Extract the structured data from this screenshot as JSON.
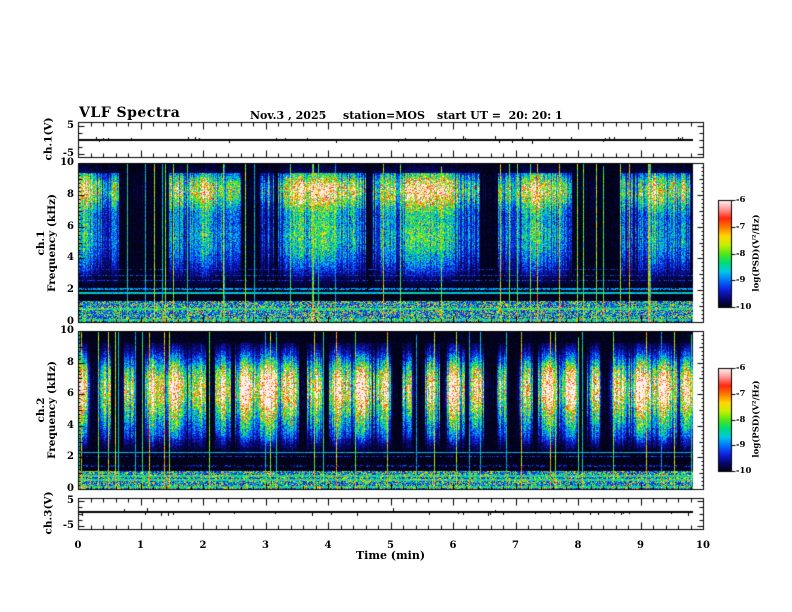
{
  "header": {
    "title": "VLF Spectra",
    "date": "Nov.3 , 2025",
    "station": "station=MOS",
    "start_ut": "start UT =  20: 20: 1"
  },
  "time_axis": {
    "label": "Time (min)",
    "ticks": [
      "0",
      "1",
      "2",
      "3",
      "4",
      "5",
      "6",
      "7",
      "8",
      "9",
      "10"
    ],
    "range_min": [
      0,
      10
    ],
    "minor_tick_step_min": 0.2,
    "data_end_min": 9.84
  },
  "chart_data": [
    {
      "id": "ch1_waveform",
      "type": "line",
      "ylabel": "ch.1(V)",
      "yticks": [
        5,
        -5
      ],
      "ylim": [
        -6.25,
        6.25
      ],
      "x_minutes": [
        0,
        9.84
      ],
      "mean_v": 0,
      "description": "flat trace near 0 V with sparse tiny impulses"
    },
    {
      "id": "ch1_spectrogram",
      "type": "heatmap",
      "ylabel_channel": "ch.1",
      "ylabel_axis": "Frequency (kHz)",
      "yticks": [
        0,
        2,
        4,
        6,
        8,
        10
      ],
      "ylim_khz": [
        0,
        10
      ],
      "x_minutes": [
        0,
        9.84
      ],
      "z_label": "log(PSD)(V²/Hz)",
      "z_range": [
        -10,
        -6
      ],
      "features": {
        "strong_band_khz": [
          6.5,
          9.4
        ],
        "peak_khz": 8.4,
        "mid_band_khz": [
          3,
          6.5
        ],
        "quiet_top_khz": [
          9.45,
          10
        ],
        "dark_gap_khz": [
          1.3,
          1.8
        ],
        "horizontal_lines_khz": [
          1.8,
          2.08,
          2.62,
          2.95,
          3.3
        ],
        "bottom_band_khz": [
          0,
          1.3
        ],
        "vertical_striations": true,
        "impulse_lines": true
      }
    },
    {
      "id": "ch2_spectrogram",
      "type": "heatmap",
      "ylabel_channel": "ch.2",
      "ylabel_axis": "Frequency (kHz)",
      "yticks": [
        0,
        2,
        4,
        6,
        8,
        10
      ],
      "ylim_khz": [
        0,
        10
      ],
      "x_minutes": [
        0,
        9.84
      ],
      "z_label": "log(PSD)(V²/Hz)",
      "z_range": [
        -10,
        -6
      ],
      "features": {
        "strong_band_khz": [
          3.5,
          9.2
        ],
        "peak_khz": 6.6,
        "blob_period_min": 0.37,
        "quiet_top_khz": [
          9.3,
          10
        ],
        "dark_gap_khz": [
          1.1,
          1.9
        ],
        "horizontal_lines_khz": [
          2.32,
          2.05,
          1.45,
          1.0
        ],
        "bottom_band_khz": [
          0,
          1.1
        ],
        "vertical_striations": true,
        "impulse_lines": true
      }
    },
    {
      "id": "ch3_waveform",
      "type": "line",
      "ylabel": "ch.3(V)",
      "yticks": [
        5,
        -5
      ],
      "ylim": [
        -6.25,
        6.25
      ],
      "x_minutes": [
        0,
        9.84
      ],
      "mean_v": 0,
      "description": "flat trace near 0 V with sparse tiny downward impulses"
    }
  ],
  "colorbar": {
    "label": "log(PSD)(V²/Hz)",
    "ticks": [
      "-6",
      "-7",
      "-8",
      "-9",
      "-10"
    ],
    "value_top": -6,
    "value_bottom": -10,
    "colormap_stops": [
      "#020210",
      "#080870",
      "#1020e0",
      "#0070ff",
      "#00c8e8",
      "#00dc78",
      "#50e818",
      "#c8f000",
      "#ffd800",
      "#ff7800",
      "#ff2810",
      "#ff9898",
      "#fff0f0"
    ]
  },
  "colors": {
    "background": "#ffffff",
    "frame": "#000000",
    "text": "#000000"
  }
}
